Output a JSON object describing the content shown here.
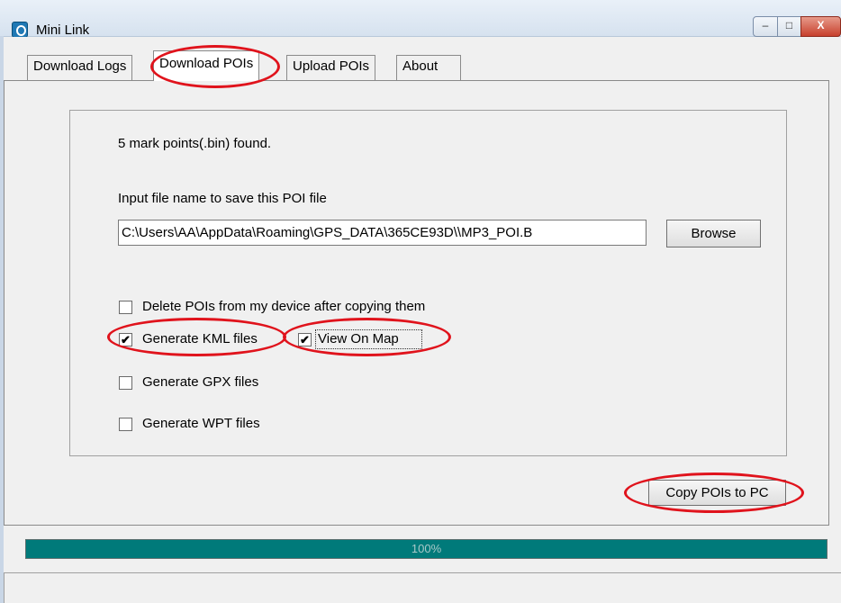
{
  "window": {
    "title": "Mini Link",
    "minimize": "‒",
    "maximize": "□",
    "close": "X"
  },
  "tabs": [
    {
      "label": "Download Logs",
      "active": false
    },
    {
      "label": "Download POIs",
      "active": true
    },
    {
      "label": "Upload POIs",
      "active": false
    },
    {
      "label": "About",
      "active": false
    }
  ],
  "panel": {
    "status_text": "5 mark points(.bin) found.",
    "input_label": "Input  file name  to save this POI file",
    "file_path": "C:\\Users\\AA\\AppData\\Roaming\\GPS_DATA\\365CE93D\\\\MP3_POI.B",
    "browse_label": "Browse",
    "delete_pois_label": "Delete POIs from my device after copying them",
    "delete_pois_checked": false,
    "generate_kml_label": "Generate KML files",
    "generate_kml_checked": true,
    "view_on_map_label": "View On  Map",
    "view_on_map_checked": true,
    "generate_gpx_label": "Generate GPX files",
    "generate_gpx_checked": false,
    "generate_wpt_label": "Generate WPT files",
    "generate_wpt_checked": false,
    "copy_label": "Copy POIs to PC"
  },
  "progress": {
    "value": 1.0,
    "text": "100%"
  },
  "colors": {
    "progress_fill": "#007a7a",
    "annotation": "#e0131c"
  },
  "check_mark": "✔"
}
